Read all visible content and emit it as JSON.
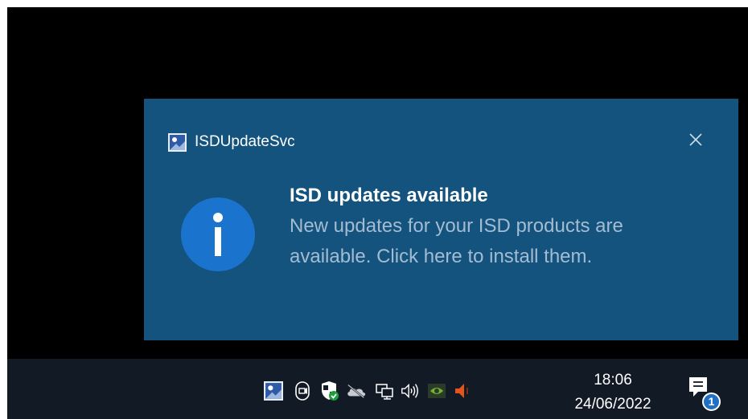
{
  "toast": {
    "app_name": "ISDUpdateSvc",
    "title": "ISD updates available",
    "message": "New updates for your ISD products are available. Click here to install them.",
    "background": "#14537e"
  },
  "taskbar": {
    "tray_icons": [
      "isd-update-icon",
      "meet-now-icon",
      "windows-security-icon",
      "onedrive-icon",
      "network-icon",
      "volume-icon",
      "nvidia-icon",
      "speaker-muted-icon"
    ],
    "clock": {
      "time": "18:06",
      "date": "24/06/2022"
    },
    "notification_count": "1"
  },
  "colors": {
    "accent": "#1a73cc",
    "taskbar": "#111a25",
    "security_green": "#1f9d3e",
    "warning_orange": "#e2541b"
  }
}
